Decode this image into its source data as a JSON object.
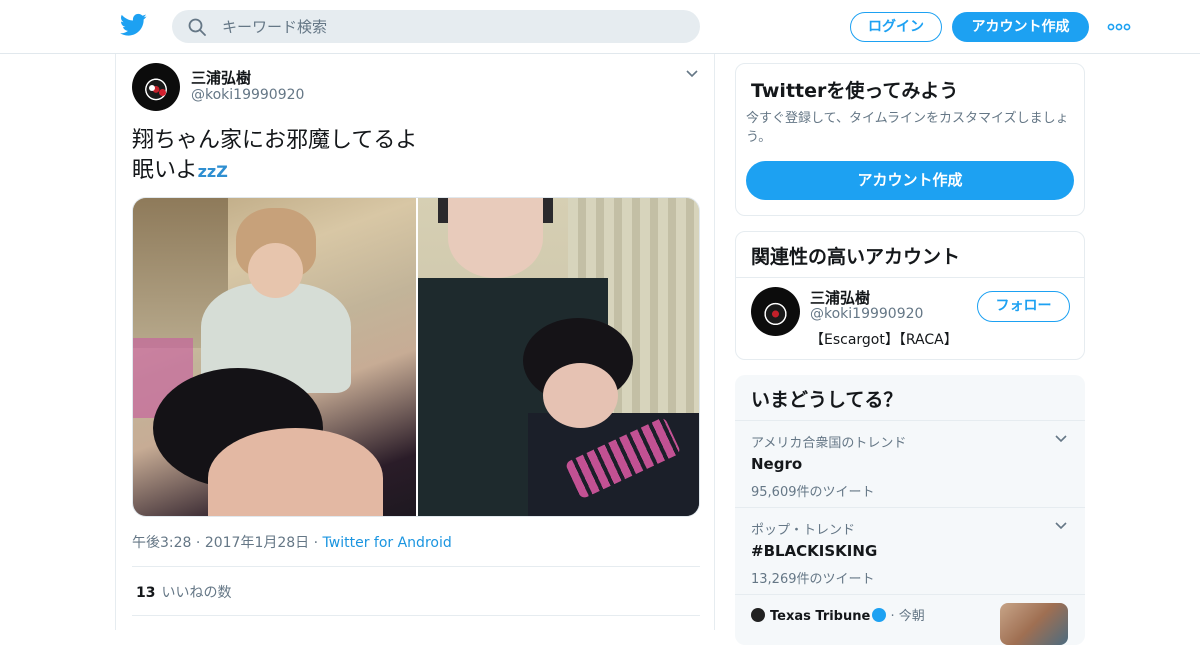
{
  "header": {
    "search_placeholder": "キーワード検索",
    "login_label": "ログイン",
    "signup_label": "アカウント作成"
  },
  "tweet": {
    "display_name": "三浦弘樹",
    "handle": "@koki19990920",
    "text_line1": "翔ちゃん家にお邪魔してるよ",
    "text_line2": "眠いよ",
    "text_emoji": "zzZ",
    "time": "午後3:28",
    "date": "2017年1月28日",
    "source": "Twitter for Android",
    "like_count": "13",
    "like_label": "いいねの数"
  },
  "signup_card": {
    "title": "Twitterを使ってみよう",
    "description": "今すぐ登録して、タイムラインをカスタマイズしましょう。",
    "button_label": "アカウント作成"
  },
  "related": {
    "title": "関連性の高いアカウント",
    "name": "三浦弘樹",
    "handle": "@koki19990920",
    "bio": "【Escargot】【RACA】",
    "follow_label": "フォロー"
  },
  "trends": {
    "title": "いまどうしてる？",
    "items": [
      {
        "context": "アメリカ合衆国のトレンド",
        "name": "Negro",
        "count": "95,609件のツイート"
      },
      {
        "context": "ポップ・トレンド",
        "name": "#BLACKISKING",
        "count": "13,269件のツイート"
      }
    ],
    "news": {
      "source": "Texas Tribune",
      "time": "今朝"
    }
  },
  "colors": {
    "accent": "#1da1f2",
    "text": "#14171a",
    "muted": "#657786"
  }
}
